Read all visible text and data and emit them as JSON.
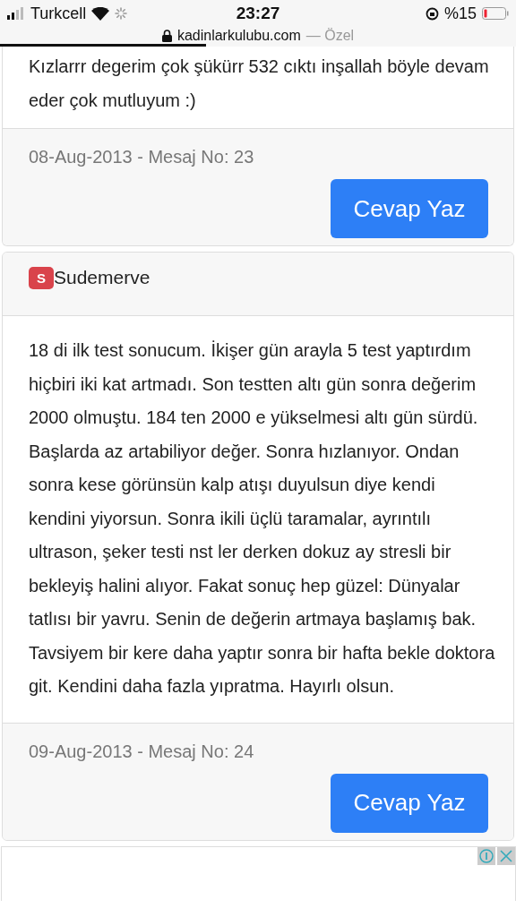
{
  "status_bar": {
    "carrier": "Turkcell",
    "time": "23:27",
    "battery": "%15"
  },
  "address_bar": {
    "domain": "kadinlarkulubu.com",
    "suffix": "— Özel",
    "loading": {
      "level": 0.4
    }
  },
  "posts": [
    {
      "body": "Kızlarrr degerim çok şükürr 532 cıktı inşallah böyle devam eder çok mutluyum :)",
      "date_line": "08-Aug-2013 - Mesaj No: 23",
      "reply_button": "Cevap Yaz"
    },
    {
      "author": {
        "initial": "S",
        "name": "Sudemerve"
      },
      "body": "18 di ilk test sonucum. İkişer gün arayla 5 test yaptırdım hiçbiri iki kat artmadı. Son testten altı gün sonra değerim 2000 olmuştu. 184 ten 2000 e yükselmesi altı gün sürdü. Başlarda az artabiliyor değer. Sonra hızlanıyor. Ondan sonra kese görünsün kalp atışı duyulsun diye kendi kendini yiyorsun. Sonra ikili üçlü taramalar, ayrıntılı ultrason, şeker testi nst ler derken dokuz ay stresli bir bekleyiş halini alıyor. Fakat sonuç hep güzel: Dünyalar tatlısı bir yavru. Senin de değerin artmaya başlamış bak. Tavsiyem bir kere daha yaptır sonra bir hafta bekle doktora git. Kendini daha fazla yıpratma. Hayırlı olsun.",
      "date_line": "09-Aug-2013 - Mesaj No: 24",
      "reply_button": "Cevap Yaz"
    }
  ]
}
